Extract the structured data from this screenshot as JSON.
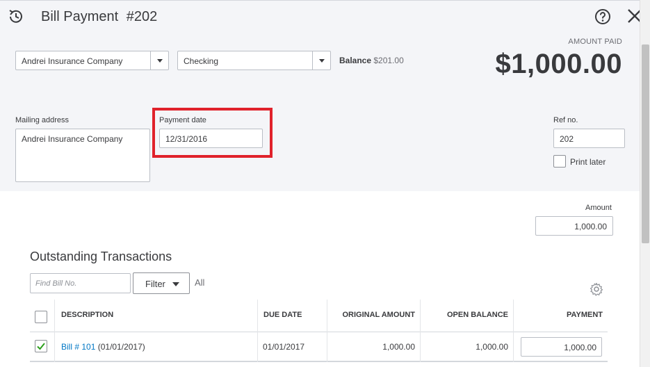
{
  "header": {
    "title": "Bill Payment",
    "number": "#202"
  },
  "payee": {
    "selected": "Andrei Insurance Company"
  },
  "account": {
    "selected": "Checking",
    "balance_label": "Balance",
    "balance_value": "$201.00"
  },
  "amount_paid": {
    "label": "AMOUNT PAID",
    "value": "$1,000.00"
  },
  "mailing_address": {
    "label": "Mailing address",
    "value": "Andrei Insurance Company"
  },
  "payment_date": {
    "label": "Payment date",
    "value": "12/31/2016"
  },
  "ref_no": {
    "label": "Ref no.",
    "value": "202"
  },
  "print_later": {
    "label": "Print later",
    "checked": false
  },
  "amount": {
    "label": "Amount",
    "value": "1,000.00"
  },
  "outstanding": {
    "title": "Outstanding Transactions",
    "find_placeholder": "Find Bill No.",
    "filter_label": "Filter",
    "filter_value": "All",
    "columns": [
      "DESCRIPTION",
      "DUE DATE",
      "ORIGINAL AMOUNT",
      "OPEN BALANCE",
      "PAYMENT"
    ],
    "rows": [
      {
        "checked": true,
        "bill_link": "Bill # 101",
        "bill_date": "(01/01/2017)",
        "due_date": "01/01/2017",
        "original_amount": "1,000.00",
        "open_balance": "1,000.00",
        "payment": "1,000.00"
      }
    ]
  },
  "icons": {
    "history": "history-icon",
    "help": "help-icon",
    "close": "close-icon",
    "gear": "gear-icon",
    "check": "check-icon",
    "caret": "chevron-down-icon"
  },
  "colors": {
    "highlight": "#e0222b",
    "link": "#0077c5",
    "check": "#2ca01c",
    "header_bg": "#f4f5f8"
  }
}
